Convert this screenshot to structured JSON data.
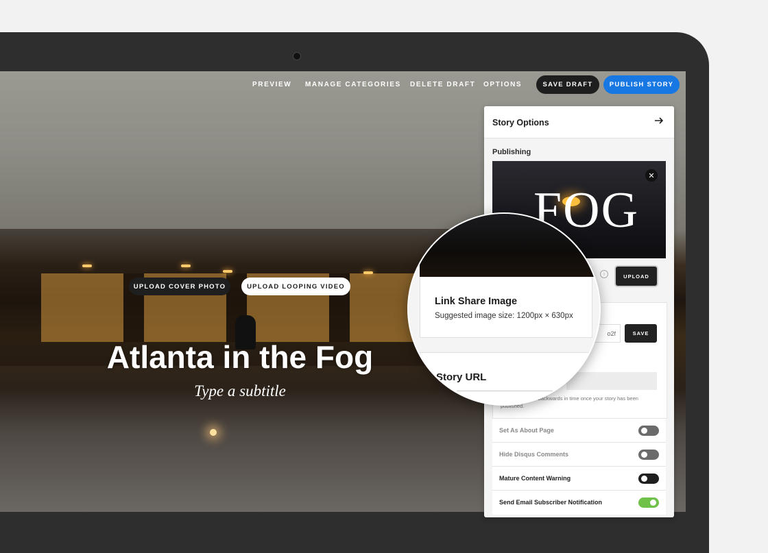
{
  "nav": {
    "preview": "PREVIEW",
    "manage_categories": "MANAGE CATEGORIES",
    "delete_draft": "DELETE DRAFT",
    "options": "OPTIONS",
    "save_draft": "SAVE DRAFT",
    "publish_story": "PUBLISH STORY"
  },
  "editor": {
    "upload_cover_photo": "UPLOAD COVER PHOTO",
    "upload_looping_video": "UPLOAD LOOPING VIDEO",
    "title": "Atlanta in the Fog",
    "subtitle_placeholder": "Type a subtitle"
  },
  "panel": {
    "title": "Story Options",
    "section_publishing": "Publishing",
    "preview_image_text": "FOG",
    "upload_label": "UPLOAD",
    "url_value_fragment": "o2f",
    "save_label": "SAVE",
    "help_text": "...ate forward or backwards in time once your story has been published.",
    "toggles": [
      {
        "label": "Set As About Page",
        "on": false
      },
      {
        "label": "Hide Disqus Comments",
        "on": false
      },
      {
        "label": "Mature Content Warning",
        "on": false
      },
      {
        "label": "Send Email Subscriber Notification",
        "on": true
      }
    ]
  },
  "magnifier": {
    "title": "Link Share Image",
    "subtitle": "Suggested image size: 1200px × 630px",
    "next_section": "Story URL"
  },
  "colors": {
    "accent_blue": "#1777e3",
    "toggle_on": "#6fc14a",
    "toggle_off": "#6b6b6b",
    "toggle_dark": "#1f1f1f"
  },
  "icons": [
    "arrow-right-icon",
    "close-icon",
    "info-icon",
    "camera-icon"
  ]
}
